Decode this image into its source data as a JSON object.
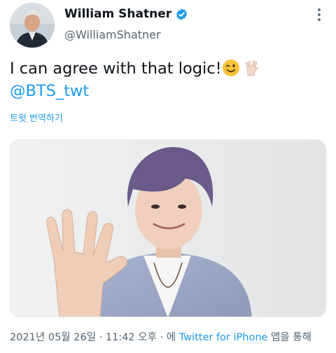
{
  "author": {
    "name": "William Shatner",
    "handle": "@WilliamShatner",
    "verified": true
  },
  "tweet": {
    "text_line1": "I can agree with that logic!",
    "emojis": [
      "winking-face-emoji",
      "vulcan-salute-emoji"
    ],
    "mention": "@BTS_twt",
    "translate_label": "트윗 번역하기"
  },
  "media": {
    "type": "photo"
  },
  "meta": {
    "date": "2021년 05월 26일",
    "separator1": " · ",
    "time": "11:42 오후",
    "separator2": " · ",
    "via_prefix": "에 ",
    "source": "Twitter for iPhone",
    "via_suffix": " 앱을 통해"
  },
  "colors": {
    "accent": "#1d9bf0",
    "secondary_text": "#536471",
    "primary_text": "#0f1419"
  }
}
